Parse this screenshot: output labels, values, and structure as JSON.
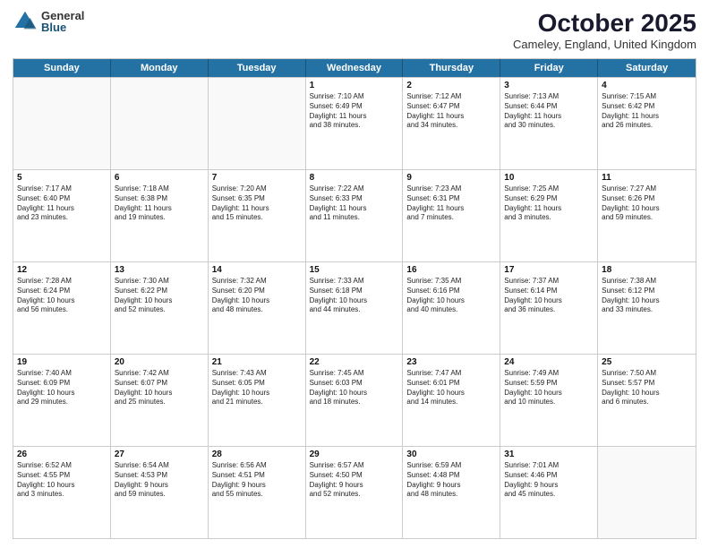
{
  "header": {
    "logo_general": "General",
    "logo_blue": "Blue",
    "month_title": "October 2025",
    "location": "Cameley, England, United Kingdom"
  },
  "weekdays": [
    "Sunday",
    "Monday",
    "Tuesday",
    "Wednesday",
    "Thursday",
    "Friday",
    "Saturday"
  ],
  "rows": [
    [
      {
        "day": "",
        "info": "",
        "empty": true
      },
      {
        "day": "",
        "info": "",
        "empty": true
      },
      {
        "day": "",
        "info": "",
        "empty": true
      },
      {
        "day": "1",
        "info": "Sunrise: 7:10 AM\nSunset: 6:49 PM\nDaylight: 11 hours\nand 38 minutes."
      },
      {
        "day": "2",
        "info": "Sunrise: 7:12 AM\nSunset: 6:47 PM\nDaylight: 11 hours\nand 34 minutes."
      },
      {
        "day": "3",
        "info": "Sunrise: 7:13 AM\nSunset: 6:44 PM\nDaylight: 11 hours\nand 30 minutes."
      },
      {
        "day": "4",
        "info": "Sunrise: 7:15 AM\nSunset: 6:42 PM\nDaylight: 11 hours\nand 26 minutes."
      }
    ],
    [
      {
        "day": "5",
        "info": "Sunrise: 7:17 AM\nSunset: 6:40 PM\nDaylight: 11 hours\nand 23 minutes."
      },
      {
        "day": "6",
        "info": "Sunrise: 7:18 AM\nSunset: 6:38 PM\nDaylight: 11 hours\nand 19 minutes."
      },
      {
        "day": "7",
        "info": "Sunrise: 7:20 AM\nSunset: 6:35 PM\nDaylight: 11 hours\nand 15 minutes."
      },
      {
        "day": "8",
        "info": "Sunrise: 7:22 AM\nSunset: 6:33 PM\nDaylight: 11 hours\nand 11 minutes."
      },
      {
        "day": "9",
        "info": "Sunrise: 7:23 AM\nSunset: 6:31 PM\nDaylight: 11 hours\nand 7 minutes."
      },
      {
        "day": "10",
        "info": "Sunrise: 7:25 AM\nSunset: 6:29 PM\nDaylight: 11 hours\nand 3 minutes."
      },
      {
        "day": "11",
        "info": "Sunrise: 7:27 AM\nSunset: 6:26 PM\nDaylight: 10 hours\nand 59 minutes."
      }
    ],
    [
      {
        "day": "12",
        "info": "Sunrise: 7:28 AM\nSunset: 6:24 PM\nDaylight: 10 hours\nand 56 minutes."
      },
      {
        "day": "13",
        "info": "Sunrise: 7:30 AM\nSunset: 6:22 PM\nDaylight: 10 hours\nand 52 minutes."
      },
      {
        "day": "14",
        "info": "Sunrise: 7:32 AM\nSunset: 6:20 PM\nDaylight: 10 hours\nand 48 minutes."
      },
      {
        "day": "15",
        "info": "Sunrise: 7:33 AM\nSunset: 6:18 PM\nDaylight: 10 hours\nand 44 minutes."
      },
      {
        "day": "16",
        "info": "Sunrise: 7:35 AM\nSunset: 6:16 PM\nDaylight: 10 hours\nand 40 minutes."
      },
      {
        "day": "17",
        "info": "Sunrise: 7:37 AM\nSunset: 6:14 PM\nDaylight: 10 hours\nand 36 minutes."
      },
      {
        "day": "18",
        "info": "Sunrise: 7:38 AM\nSunset: 6:12 PM\nDaylight: 10 hours\nand 33 minutes."
      }
    ],
    [
      {
        "day": "19",
        "info": "Sunrise: 7:40 AM\nSunset: 6:09 PM\nDaylight: 10 hours\nand 29 minutes."
      },
      {
        "day": "20",
        "info": "Sunrise: 7:42 AM\nSunset: 6:07 PM\nDaylight: 10 hours\nand 25 minutes."
      },
      {
        "day": "21",
        "info": "Sunrise: 7:43 AM\nSunset: 6:05 PM\nDaylight: 10 hours\nand 21 minutes."
      },
      {
        "day": "22",
        "info": "Sunrise: 7:45 AM\nSunset: 6:03 PM\nDaylight: 10 hours\nand 18 minutes."
      },
      {
        "day": "23",
        "info": "Sunrise: 7:47 AM\nSunset: 6:01 PM\nDaylight: 10 hours\nand 14 minutes."
      },
      {
        "day": "24",
        "info": "Sunrise: 7:49 AM\nSunset: 5:59 PM\nDaylight: 10 hours\nand 10 minutes."
      },
      {
        "day": "25",
        "info": "Sunrise: 7:50 AM\nSunset: 5:57 PM\nDaylight: 10 hours\nand 6 minutes."
      }
    ],
    [
      {
        "day": "26",
        "info": "Sunrise: 6:52 AM\nSunset: 4:55 PM\nDaylight: 10 hours\nand 3 minutes."
      },
      {
        "day": "27",
        "info": "Sunrise: 6:54 AM\nSunset: 4:53 PM\nDaylight: 9 hours\nand 59 minutes."
      },
      {
        "day": "28",
        "info": "Sunrise: 6:56 AM\nSunset: 4:51 PM\nDaylight: 9 hours\nand 55 minutes."
      },
      {
        "day": "29",
        "info": "Sunrise: 6:57 AM\nSunset: 4:50 PM\nDaylight: 9 hours\nand 52 minutes."
      },
      {
        "day": "30",
        "info": "Sunrise: 6:59 AM\nSunset: 4:48 PM\nDaylight: 9 hours\nand 48 minutes."
      },
      {
        "day": "31",
        "info": "Sunrise: 7:01 AM\nSunset: 4:46 PM\nDaylight: 9 hours\nand 45 minutes."
      },
      {
        "day": "",
        "info": "",
        "empty": true
      }
    ]
  ]
}
